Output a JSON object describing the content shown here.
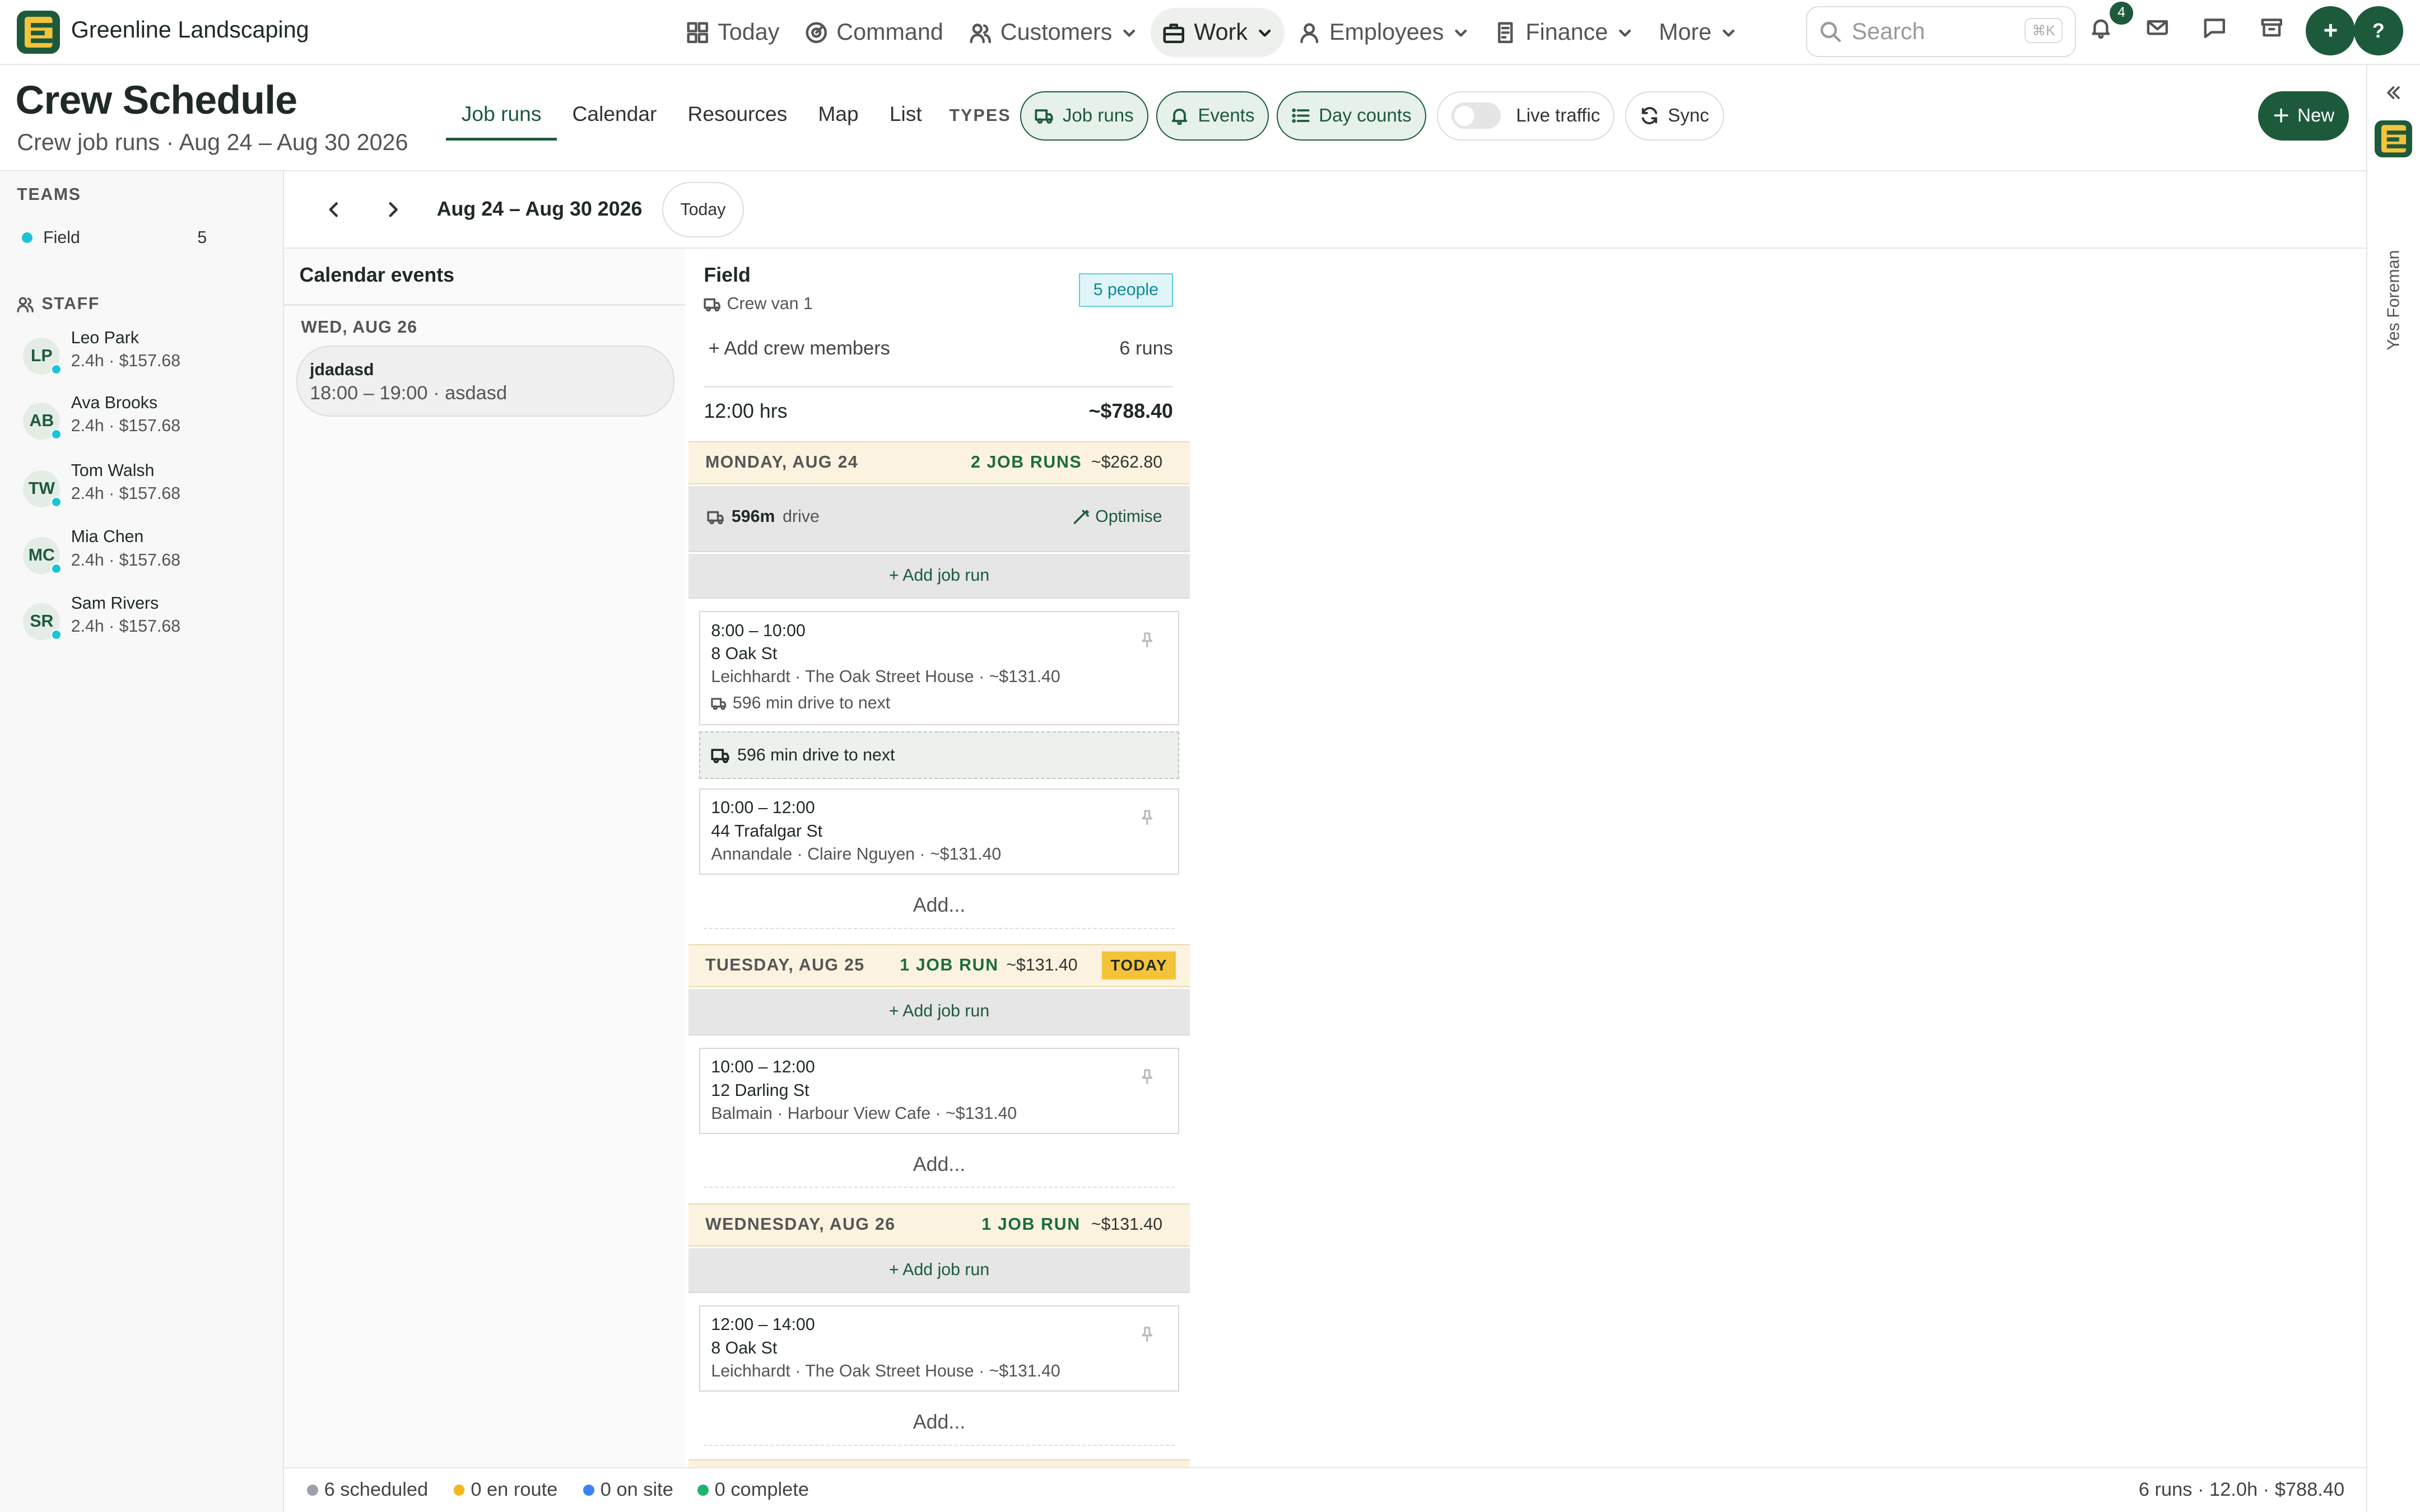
{
  "app": {
    "brand": "Greenline Landscaping"
  },
  "colors": {
    "brand": "#1d5a3c",
    "accent_cyan": "#1cc3d8",
    "today_badge": "#f4c33a",
    "day_header": "#fbf3df"
  },
  "nav": {
    "items": [
      {
        "label": "Today",
        "icon": "grid-icon"
      },
      {
        "label": "Command",
        "icon": "radar-icon"
      },
      {
        "label": "Customers",
        "icon": "users-icon",
        "dropdown": true
      },
      {
        "label": "Work",
        "icon": "briefcase-icon",
        "dropdown": true,
        "active": true
      },
      {
        "label": "Employees",
        "icon": "user-icon",
        "dropdown": true
      },
      {
        "label": "Finance",
        "icon": "invoice-icon",
        "dropdown": true
      },
      {
        "label": "More",
        "dropdown": true
      }
    ],
    "search_placeholder": "Search",
    "search_shortcut": "⌘K",
    "notification_count": "4",
    "add_label": "+",
    "help_label": "?"
  },
  "header": {
    "title": "Crew Schedule",
    "subtitle": "Crew job runs · Aug 24 – Aug 30 2026",
    "tabs": [
      "Job runs",
      "Calendar",
      "Resources",
      "Map",
      "List"
    ],
    "types_label": "TYPES",
    "type_pills": [
      "Job runs",
      "Events",
      "Day counts"
    ],
    "live_traffic": "Live traffic",
    "sync": "Sync",
    "new": "New"
  },
  "rail": {
    "label": "Yes Foreman"
  },
  "sidebar": {
    "teams_label": "TEAMS",
    "teams": [
      {
        "name": "Field",
        "count": "5"
      }
    ],
    "staff_label": "STAFF",
    "staff": [
      {
        "initials": "LP",
        "name": "Leo Park",
        "meta": "2.4h · $157.68"
      },
      {
        "initials": "AB",
        "name": "Ava Brooks",
        "meta": "2.4h · $157.68"
      },
      {
        "initials": "TW",
        "name": "Tom Walsh",
        "meta": "2.4h · $157.68"
      },
      {
        "initials": "MC",
        "name": "Mia Chen",
        "meta": "2.4h · $157.68"
      },
      {
        "initials": "SR",
        "name": "Sam Rivers",
        "meta": "2.4h · $157.68"
      }
    ]
  },
  "toolbar": {
    "range": "Aug 24 – Aug 30 2026",
    "today": "Today"
  },
  "calendar": {
    "heading": "Calendar events",
    "day": "WED, AUG 26",
    "event": {
      "title": "jdadasd",
      "detail": "18:00 – 19:00 · asdasd"
    }
  },
  "field": {
    "title": "Field",
    "vehicle": "Crew van 1",
    "people": "5 people",
    "add_crew": "+ Add crew members",
    "runs": "6 runs",
    "hours": "12:00 hrs",
    "total": "~$788.40",
    "days": [
      {
        "name": "MONDAY, AUG 24",
        "runs": "2 JOB RUNS",
        "amount": "~$262.80",
        "drive_value": "596m",
        "drive_label": "drive",
        "optimise": "Optimise",
        "add_run": "+ Add job run",
        "jobs": [
          {
            "time": "8:00 – 10:00",
            "address": "8 Oak St",
            "detail": "Leichhardt · The Oak Street House · ~$131.40",
            "drive": "596 min drive to next"
          },
          {
            "time": "10:00 – 12:00",
            "address": "44 Trafalgar St",
            "detail": "Annandale · Claire Nguyen · ~$131.40"
          }
        ],
        "drive_between": "596 min drive to next",
        "add": "Add..."
      },
      {
        "name": "TUESDAY, AUG 25",
        "runs": "1 JOB RUN",
        "amount": "~$131.40",
        "today": "TODAY",
        "add_run": "+ Add job run",
        "jobs": [
          {
            "time": "10:00 – 12:00",
            "address": "12 Darling St",
            "detail": "Balmain · Harbour View Cafe · ~$131.40"
          }
        ],
        "add": "Add..."
      },
      {
        "name": "WEDNESDAY, AUG 26",
        "runs": "1 JOB RUN",
        "amount": "~$131.40",
        "add_run": "+ Add job run",
        "jobs": [
          {
            "time": "12:00 – 14:00",
            "address": "8 Oak St",
            "detail": "Leichhardt · The Oak Street House · ~$131.40"
          }
        ],
        "add": "Add..."
      }
    ]
  },
  "footer": {
    "stats": [
      {
        "label": "6 scheduled",
        "color": "#9aa3ad"
      },
      {
        "label": "0 en route",
        "color": "#f2b61f"
      },
      {
        "label": "0 on site",
        "color": "#3b82f6"
      },
      {
        "label": "0 complete",
        "color": "#22b36b"
      }
    ],
    "summary": "6 runs · 12.0h · $788.40"
  }
}
